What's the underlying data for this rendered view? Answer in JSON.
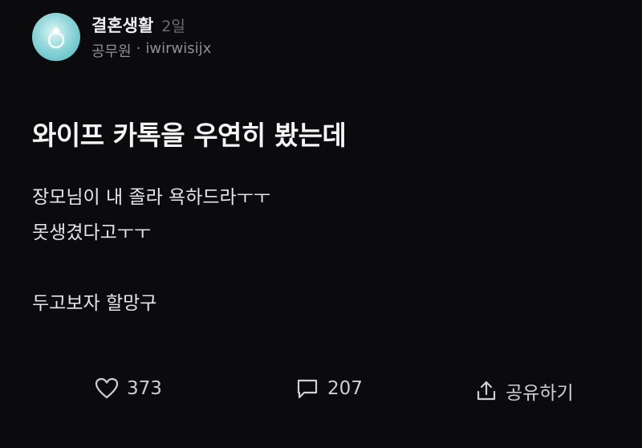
{
  "post": {
    "channel_name": "결혼생활",
    "time_ago": "2일",
    "author_job": "공무원",
    "separator": "·",
    "author_id": "iwirwisijx",
    "title": "와이프 카톡을 우연히 봤는데",
    "body_lines": [
      "장모님이 내 졸라 욕하드라ㅜㅜ",
      "못생겼다고ㅜㅜ",
      "",
      "두고보자 할망구"
    ]
  },
  "actions": {
    "like_icon": "heart-icon",
    "like_count": "373",
    "comment_icon": "comment-bubble-icon",
    "comment_count": "207",
    "share_icon": "share-upload-icon",
    "share_label": "공유하기"
  },
  "colors": {
    "background": "#0b0b0d",
    "text_primary": "#f2f2f2",
    "text_secondary": "#8f8f94",
    "avatar_accent": "#4cb4bb"
  }
}
